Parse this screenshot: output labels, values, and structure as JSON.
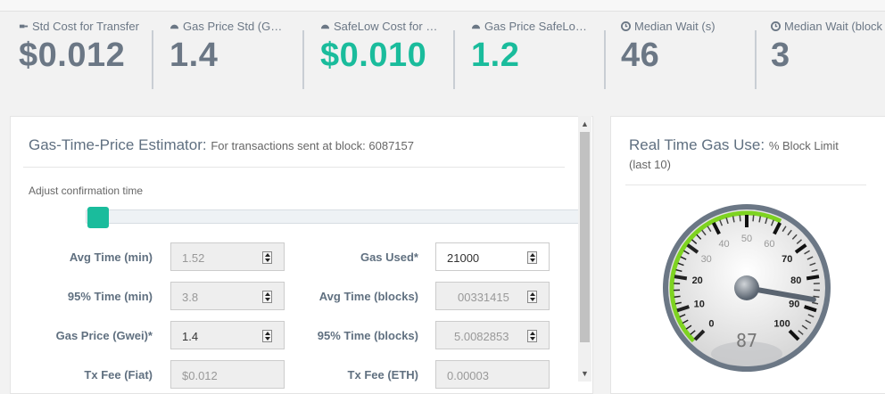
{
  "stats": [
    {
      "icon": "gas-pump-icon",
      "label": "Std Cost for Transfer",
      "value": "$0.012",
      "green": false
    },
    {
      "icon": "dashboard-icon",
      "label": "Gas Price Std (G…",
      "value": "1.4",
      "green": false
    },
    {
      "icon": "dashboard-icon",
      "label": "SafeLow Cost for …",
      "value": "$0.010",
      "green": true
    },
    {
      "icon": "dashboard-icon",
      "label": "Gas Price SafeLo…",
      "value": "1.2",
      "green": true
    },
    {
      "icon": "clock-icon",
      "label": "Median Wait (s)",
      "value": "46",
      "green": false
    },
    {
      "icon": "clock-icon",
      "label": "Median Wait (block",
      "value": "3",
      "green": false
    }
  ],
  "estimator": {
    "title": "Gas-Time-Price Estimator:",
    "subtitle": "For transactions sent at block: 6087157",
    "adjust_label": "Adjust confirmation time",
    "slider_value": 0,
    "fields": {
      "avg_time_min": {
        "label": "Avg Time (min)",
        "value": "1.52"
      },
      "time95_min": {
        "label": "95% Time (min)",
        "value": "3.8"
      },
      "gas_price": {
        "label": "Gas Price (Gwei)*",
        "value": "1.4"
      },
      "tx_fee_fiat": {
        "label": "Tx Fee (Fiat)",
        "value": "$0.012"
      },
      "gas_used": {
        "label": "Gas Used*",
        "value": "21000"
      },
      "avg_time_blocks": {
        "label": "Avg Time (blocks)",
        "value": "00331415"
      },
      "time95_blocks": {
        "label": "95% Time (blocks)",
        "value": "5.0082853"
      },
      "tx_fee_eth": {
        "label": "Tx Fee (ETH)",
        "value": "0.00003"
      }
    }
  },
  "gas_use": {
    "title": "Real Time Gas Use:",
    "subtitle": "% Block Limit",
    "subtitle2": "(last 10)",
    "gauge": {
      "value": 87,
      "readout": "87",
      "min": 0,
      "max": 100,
      "ticks": [
        "0",
        "10",
        "20",
        "30",
        "40",
        "50",
        "60",
        "70",
        "80",
        "90",
        "100"
      ],
      "green_arc_to": 60,
      "colors": {
        "arc": "#7ed321",
        "rim": "#6b7785"
      }
    }
  }
}
